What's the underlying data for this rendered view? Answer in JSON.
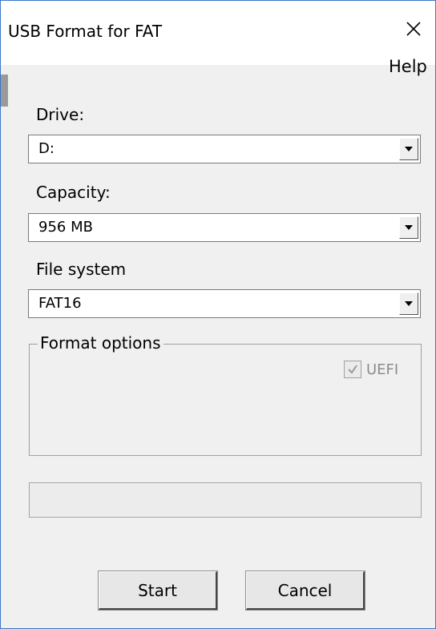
{
  "window": {
    "title": "USB Format for FAT",
    "close_icon": "close-icon"
  },
  "menu": {
    "help_label": "Help"
  },
  "drive": {
    "label": "Drive:",
    "value": "D:"
  },
  "capacity": {
    "label": "Capacity:",
    "value": "956 MB"
  },
  "filesystem": {
    "label": "File system",
    "value": "FAT16"
  },
  "format_options": {
    "legend": "Format options",
    "uefi_label": "UEFI",
    "uefi_checked": true,
    "uefi_enabled": false
  },
  "progress": {
    "value": 0
  },
  "buttons": {
    "start_label": "Start",
    "cancel_label": "Cancel"
  },
  "colors": {
    "window_border": "#3c78c8",
    "background": "#f0f0f0"
  }
}
